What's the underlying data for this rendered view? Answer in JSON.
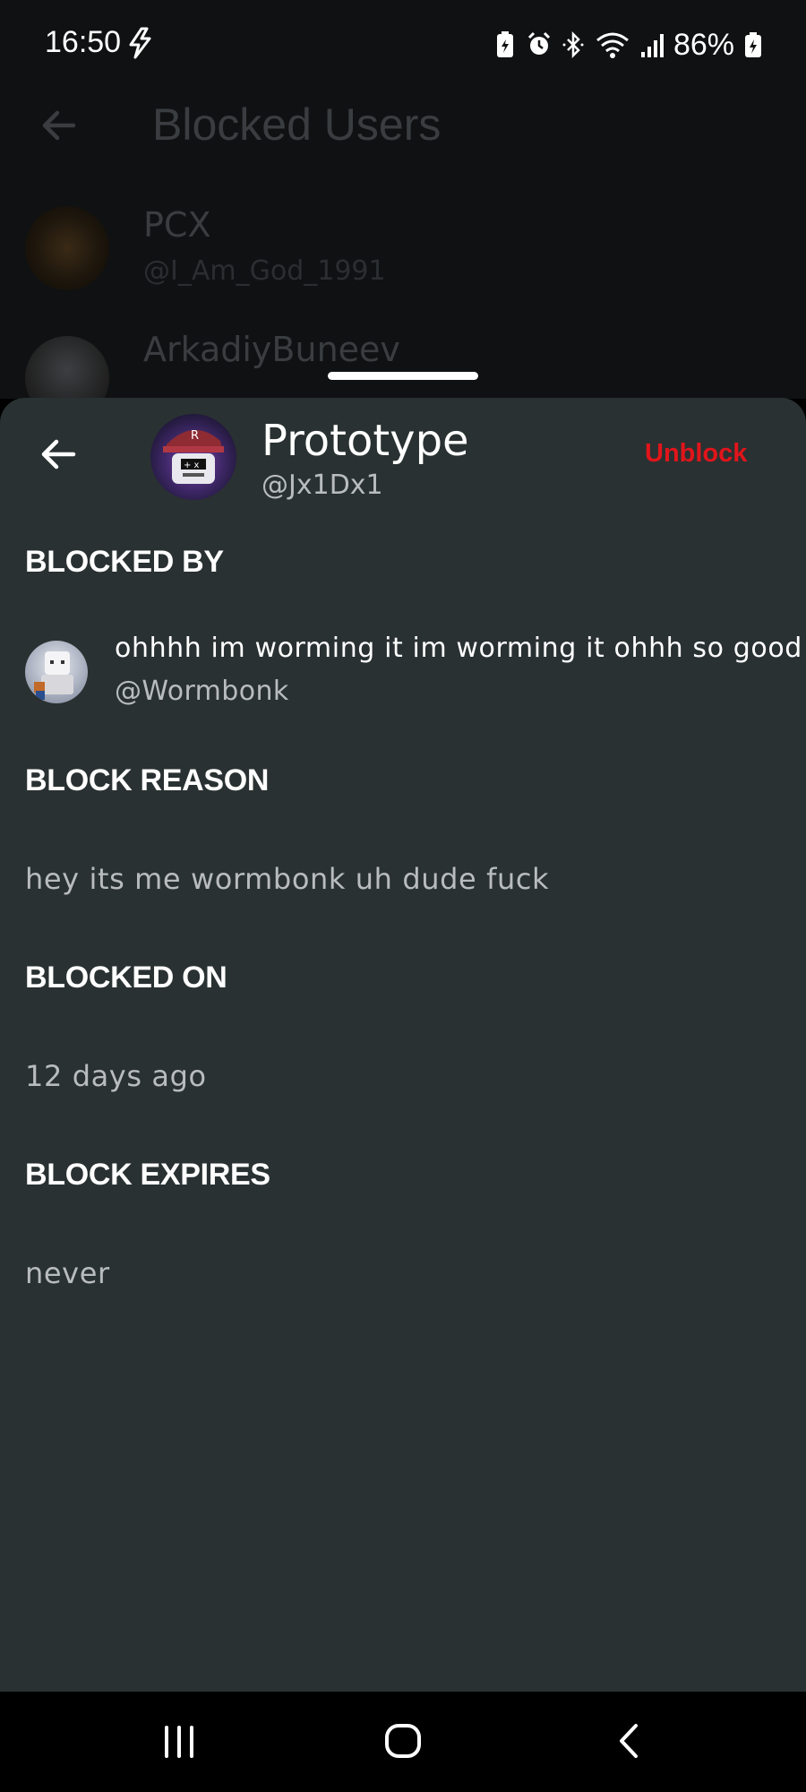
{
  "status_bar": {
    "time": "16:50",
    "battery_percent": "86%",
    "icons": [
      "charging-bolt-icon",
      "battery-saver-icon",
      "alarm-icon",
      "bluetooth-icon",
      "wifi-icon",
      "signal-icon",
      "battery-icon"
    ]
  },
  "background_screen": {
    "title": "Blocked Users",
    "items": [
      {
        "name": "PCX",
        "handle": "@I_Am_God_1991"
      },
      {
        "name": "ArkadiyBuneev",
        "handle": ""
      }
    ]
  },
  "sheet": {
    "profile": {
      "name": "Prototype",
      "handle": "@Jx1Dx1"
    },
    "unblock_label": "Unblock",
    "blocked_by": {
      "header": "BLOCKED BY",
      "name": "ohhhh im worming it im worming it ohhh so good",
      "handle": "@Wormbonk"
    },
    "block_reason": {
      "header": "BLOCK REASON",
      "value": "hey its me wormbonk uh dude fuck"
    },
    "blocked_on": {
      "header": "BLOCKED ON",
      "value": "12 days ago"
    },
    "block_expires": {
      "header": "BLOCK EXPIRES",
      "value": "never"
    }
  },
  "colors": {
    "sheet_bg": "#2a3132",
    "unblock": "#e0151b",
    "secondary_text": "#b8bcbf"
  }
}
